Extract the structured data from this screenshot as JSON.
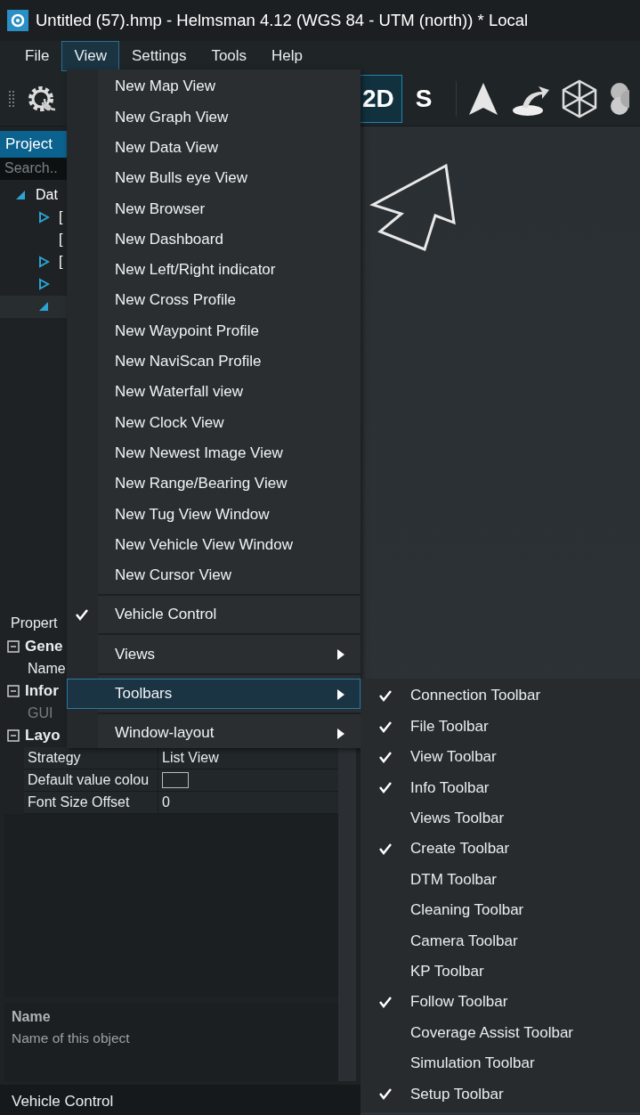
{
  "window": {
    "title": "Untitled (57).hmp - Helmsman 4.12 (WGS 84 - UTM (north)) * Local"
  },
  "menubar": [
    {
      "label": "File",
      "selected": false
    },
    {
      "label": "View",
      "selected": true
    },
    {
      "label": "Settings",
      "selected": false
    },
    {
      "label": "Tools",
      "selected": false
    },
    {
      "label": "Help",
      "selected": false
    }
  ],
  "toolbar": {
    "buttons": [
      {
        "label": "2D",
        "selected": true
      },
      {
        "label": "S",
        "selected": false
      }
    ]
  },
  "project_panel": {
    "tab": "Project",
    "search": {
      "placeholder": "Search.."
    },
    "tree": [
      {
        "label": "Dat",
        "expanded": true,
        "selected": false,
        "children": [
          {
            "label": "[",
            "expanded": false,
            "selected": false
          },
          {
            "label": "[",
            "selected": false
          },
          {
            "label": "[",
            "expanded": false,
            "selected": false
          },
          {
            "expanded": false,
            "selected": false
          },
          {
            "expanded": true,
            "selected": true
          }
        ]
      }
    ]
  },
  "properties": {
    "title": "Propert",
    "categories": [
      {
        "label": "Gene",
        "expanded": true,
        "rows": [
          {
            "name": "Name"
          }
        ]
      },
      {
        "label": "Infor",
        "expanded": true,
        "rows": [
          {
            "name": "GUI",
            "disabled": true
          }
        ]
      },
      {
        "label": "Layo",
        "expanded": true,
        "rows": [
          {
            "name": "Strategy",
            "value": "List View"
          },
          {
            "name": "Default value colou",
            "kind": "color"
          },
          {
            "name": "Font Size Offset",
            "value": "0"
          }
        ]
      }
    ],
    "description": {
      "title": "Name",
      "text": "Name of this object"
    }
  },
  "bottom_tab": "Vehicle Control",
  "view_menu": {
    "sections": [
      [
        {
          "label": "New Map View",
          "kind": "item",
          "selected": false
        },
        {
          "label": "New Graph View",
          "kind": "item",
          "selected": false
        },
        {
          "label": "New Data View",
          "kind": "item",
          "selected": false
        },
        {
          "label": "New Bulls eye View",
          "kind": "item",
          "selected": false
        },
        {
          "label": "New Browser",
          "kind": "item",
          "selected": false
        },
        {
          "label": "New Dashboard",
          "kind": "item",
          "selected": false
        },
        {
          "label": "New Left/Right indicator",
          "kind": "item",
          "selected": false
        },
        {
          "label": "New Cross Profile",
          "kind": "item",
          "selected": false
        },
        {
          "label": "New Waypoint Profile",
          "kind": "item",
          "selected": false
        },
        {
          "label": "New NaviScan Profile",
          "kind": "item",
          "selected": false
        },
        {
          "label": "New Waterfall view",
          "kind": "item",
          "selected": false
        },
        {
          "label": "New Clock View",
          "kind": "item",
          "selected": false
        },
        {
          "label": "New Newest Image View",
          "kind": "item",
          "selected": false
        },
        {
          "label": "New Range/Bearing View",
          "kind": "item",
          "selected": false
        },
        {
          "label": "New Tug View Window",
          "kind": "item",
          "selected": false
        },
        {
          "label": "New Vehicle View Window",
          "kind": "item",
          "selected": false
        },
        {
          "label": "New Cursor View",
          "kind": "item",
          "selected": false
        }
      ],
      [
        {
          "label": "Vehicle Control",
          "kind": "check",
          "checked": true,
          "selected": false
        }
      ],
      [
        {
          "label": "Views",
          "kind": "submenu",
          "selected": false
        }
      ],
      [
        {
          "label": "Toolbars",
          "kind": "submenu",
          "selected": true
        }
      ],
      [
        {
          "label": "Window-layout",
          "kind": "submenu",
          "selected": false
        }
      ]
    ]
  },
  "toolbars_submenu": [
    {
      "label": "Connection Toolbar",
      "checked": true
    },
    {
      "label": "File Toolbar",
      "checked": true
    },
    {
      "label": "View Toolbar",
      "checked": true
    },
    {
      "label": "Info Toolbar",
      "checked": true
    },
    {
      "label": "Views Toolbar",
      "checked": false
    },
    {
      "label": "Create Toolbar",
      "checked": true
    },
    {
      "label": "DTM Toolbar",
      "checked": false
    },
    {
      "label": "Cleaning Toolbar",
      "checked": false
    },
    {
      "label": "Camera Toolbar",
      "checked": false
    },
    {
      "label": "KP Toolbar",
      "checked": false
    },
    {
      "label": "Follow Toolbar",
      "checked": true
    },
    {
      "label": "Coverage Assist Toolbar",
      "checked": false
    },
    {
      "label": "Simulation Toolbar",
      "checked": false
    },
    {
      "label": "Setup Toolbar",
      "checked": true
    }
  ]
}
